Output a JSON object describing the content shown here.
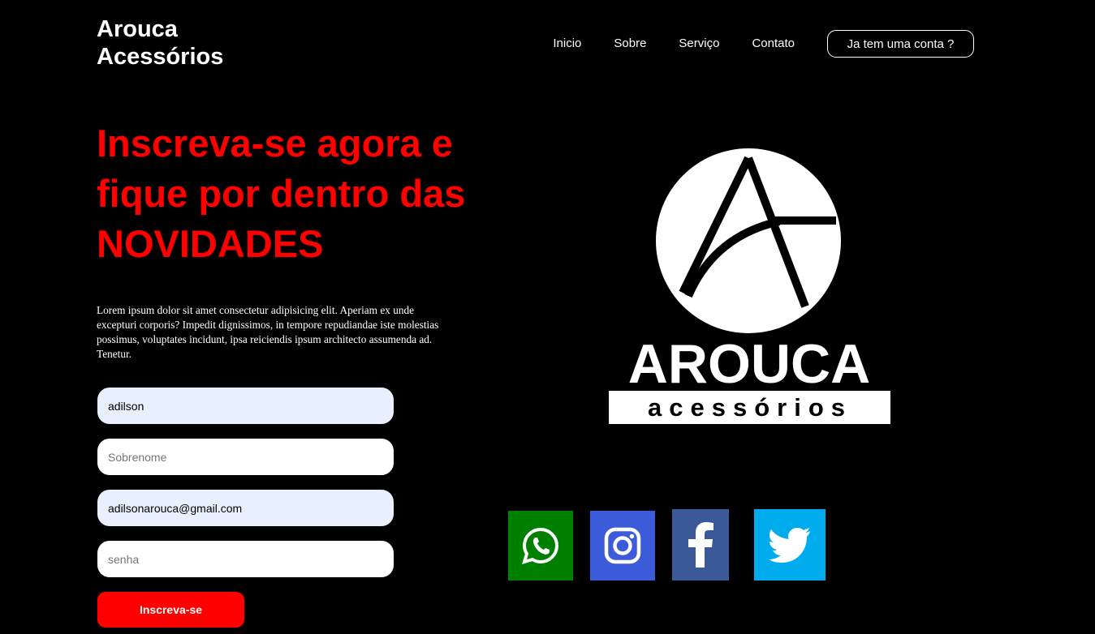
{
  "brand": {
    "line1": "Arouca",
    "line2": "Acessórios"
  },
  "nav": {
    "items": [
      {
        "label": "Inicio"
      },
      {
        "label": "Sobre"
      },
      {
        "label": "Serviço"
      },
      {
        "label": "Contato"
      }
    ],
    "account_label": "Ja tem uma conta ?"
  },
  "hero": {
    "line1": "Inscreva-se agora e",
    "line2": "fique por dentro das",
    "line3": "NOVIDADES",
    "paragraph": "Lorem ipsum dolor sit amet consectetur adipisicing elit. Aperiam ex unde excepturi corporis? Impedit dignissimos, in tempore repudiandae iste molestias possimus, voluptates incidunt, ipsa reiciendis ipsum architecto assumenda ad. Tenetur."
  },
  "form": {
    "first_name_value": "adilson",
    "last_name_placeholder": "Sobrenome",
    "email_value": "adilsonarouca@gmail.com",
    "password_placeholder": "senha",
    "submit_label": "Inscreva-se"
  },
  "logo": {
    "word1": "AROUCA",
    "word2": "acessórios"
  },
  "social": [
    {
      "name": "whatsapp-icon",
      "color": "#008000"
    },
    {
      "name": "instagram-icon",
      "color": "#3b5bdb"
    },
    {
      "name": "facebook-icon",
      "color": "#3b5998"
    },
    {
      "name": "twitter-icon",
      "color": "#00acee"
    }
  ],
  "colors": {
    "accent": "#ff0000",
    "background": "#000000",
    "autofill": "#e8f0fe"
  }
}
